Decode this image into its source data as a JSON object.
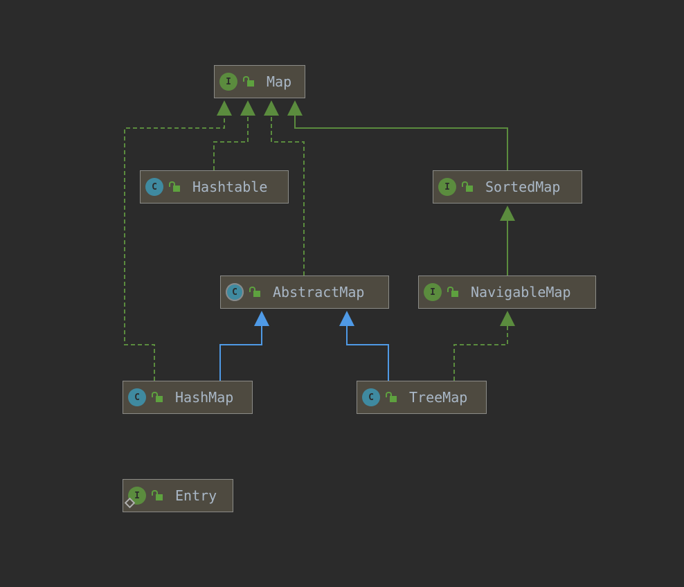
{
  "colors": {
    "background": "#2b2b2b",
    "interface_badge": "#5b8c3e",
    "class_badge": "#3f8aa0",
    "implements_edge": "#5b8c3e",
    "extends_interface_edge": "#5b8c3e",
    "extends_class_edge": "#4f9ae6",
    "node_text": "#a9b7c6"
  },
  "nodes": [
    {
      "id": "map",
      "label": "Map",
      "kind": "interface",
      "badge": "I",
      "icon": "unlocked-public-icon"
    },
    {
      "id": "hashtable",
      "label": "Hashtable",
      "kind": "class",
      "badge": "C",
      "icon": "unlocked-public-icon"
    },
    {
      "id": "sortedmap",
      "label": "SortedMap",
      "kind": "interface",
      "badge": "I",
      "icon": "unlocked-public-icon"
    },
    {
      "id": "abstractmap",
      "label": "AbstractMap",
      "kind": "abstract-class",
      "badge": "C",
      "icon": "unlocked-public-icon"
    },
    {
      "id": "navigablemap",
      "label": "NavigableMap",
      "kind": "interface",
      "badge": "I",
      "icon": "unlocked-public-icon"
    },
    {
      "id": "hashmap",
      "label": "HashMap",
      "kind": "class",
      "badge": "C",
      "icon": "unlocked-public-icon"
    },
    {
      "id": "treemap",
      "label": "TreeMap",
      "kind": "class",
      "badge": "C",
      "icon": "unlocked-public-icon"
    },
    {
      "id": "entry",
      "label": "Entry",
      "kind": "inner-interface",
      "badge": "I",
      "icon": "unlocked-public-icon"
    }
  ],
  "edges": [
    {
      "from": "hashmap",
      "to": "map",
      "type": "implements"
    },
    {
      "from": "hashtable",
      "to": "map",
      "type": "implements"
    },
    {
      "from": "abstractmap",
      "to": "map",
      "type": "implements"
    },
    {
      "from": "sortedmap",
      "to": "map",
      "type": "extends-interface"
    },
    {
      "from": "navigablemap",
      "to": "sortedmap",
      "type": "extends-interface"
    },
    {
      "from": "hashmap",
      "to": "abstractmap",
      "type": "extends-class"
    },
    {
      "from": "treemap",
      "to": "abstractmap",
      "type": "extends-class"
    },
    {
      "from": "treemap",
      "to": "navigablemap",
      "type": "implements"
    }
  ]
}
